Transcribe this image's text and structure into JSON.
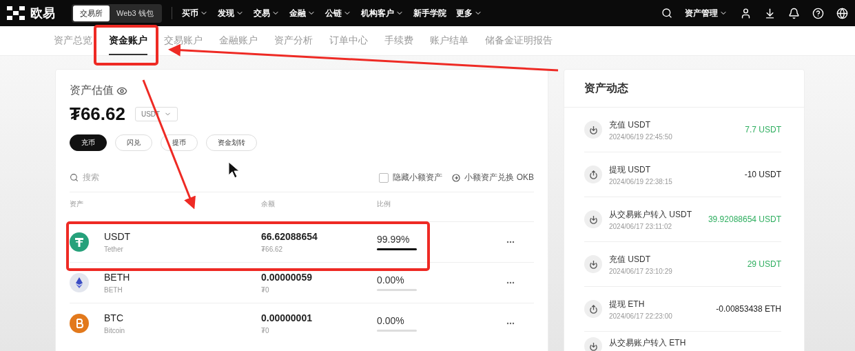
{
  "brand": {
    "name": "欧易"
  },
  "mode_switch": [
    {
      "label": "交易所",
      "selected": true
    },
    {
      "label": "Web3 钱包",
      "selected": false
    }
  ],
  "nav": [
    {
      "label": "买币",
      "dropdown": true
    },
    {
      "label": "发现",
      "dropdown": true
    },
    {
      "label": "交易",
      "dropdown": true
    },
    {
      "label": "金融",
      "dropdown": true
    },
    {
      "label": "公链",
      "dropdown": true
    },
    {
      "label": "机构客户",
      "dropdown": true
    },
    {
      "label": "新手学院",
      "dropdown": false
    },
    {
      "label": "更多",
      "dropdown": true
    }
  ],
  "asset_menu": {
    "label": "资产管理"
  },
  "subtabs": [
    {
      "label": "资产总览",
      "selected": false
    },
    {
      "label": "资金账户",
      "selected": true
    },
    {
      "label": "交易账户",
      "selected": false
    },
    {
      "label": "金融账户",
      "selected": false
    },
    {
      "label": "资产分析",
      "selected": false
    },
    {
      "label": "订单中心",
      "selected": false
    },
    {
      "label": "手续费",
      "selected": false
    },
    {
      "label": "账户结单",
      "selected": false
    },
    {
      "label": "储备金证明报告",
      "selected": false
    }
  ],
  "valuation": {
    "title": "资产估值",
    "amount": "₮66.62",
    "currency": "USDT"
  },
  "actions": [
    {
      "label": "充币",
      "primary": true
    },
    {
      "label": "闪兑",
      "primary": false
    },
    {
      "label": "提币",
      "primary": false
    },
    {
      "label": "资金划转",
      "primary": false
    }
  ],
  "search": {
    "placeholder": "搜索"
  },
  "hide_small": {
    "label": "隐藏小额资产",
    "checked": false
  },
  "convert_link": "小额资产兑换 OKB",
  "table": {
    "columns": [
      "资产",
      "余额",
      "比例"
    ],
    "rows": [
      {
        "kind": "usdt",
        "symbol": "USDT",
        "name": "Tether",
        "color": "#26a17b",
        "balance": "66.62088654",
        "value": "₮66.62",
        "ratio": "99.99%",
        "level": 1
      },
      {
        "kind": "eth",
        "symbol": "BETH",
        "name": "BETH",
        "color": "#e3e6ee",
        "balance": "0.00000059",
        "value": "₮0",
        "ratio": "0.00%",
        "level": 0
      },
      {
        "kind": "btc",
        "symbol": "BTC",
        "name": "Bitcoin",
        "color": "#e2791c",
        "balance": "0.00000001",
        "value": "₮0",
        "ratio": "0.00%",
        "level": 0
      }
    ]
  },
  "activity": {
    "title": "资产动态",
    "items": [
      {
        "kind": "in",
        "title": "充值 USDT",
        "time": "2024/06/19 22:45:50",
        "amount": "7.7 USDT"
      },
      {
        "kind": "out",
        "title": "提现 USDT",
        "time": "2024/06/19 22:38:15",
        "amount": "-10 USDT"
      },
      {
        "kind": "in",
        "title": "从交易账户转入 USDT",
        "time": "2024/06/17 23:11:02",
        "amount": "39.92088654 USDT"
      },
      {
        "kind": "in",
        "title": "充值 USDT",
        "time": "2024/06/17 23:10:29",
        "amount": "29 USDT"
      },
      {
        "kind": "out",
        "title": "提现 ETH",
        "time": "2024/06/17 22:23:00",
        "amount": "-0.00853438 ETH"
      },
      {
        "kind": "in",
        "title": "从交易账户转入 ETH"
      }
    ]
  }
}
